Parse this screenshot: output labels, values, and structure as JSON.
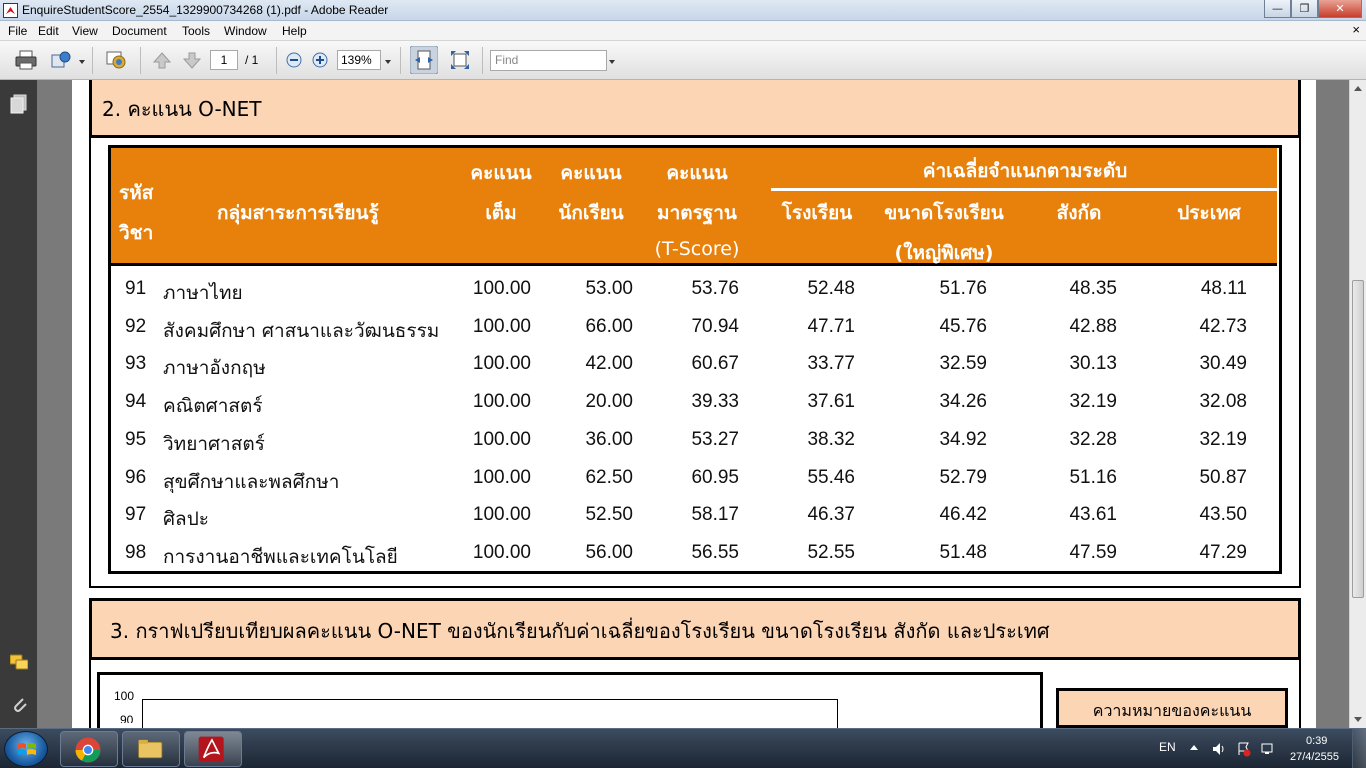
{
  "window": {
    "title": "EnquireStudentScore_2554_1329900734268 (1).pdf - Adobe Reader",
    "minimize_glyph": "—",
    "restore_glyph": "❐",
    "close_glyph": "✕"
  },
  "menu": {
    "items": [
      "File",
      "Edit",
      "View",
      "Document",
      "Tools",
      "Window",
      "Help"
    ],
    "doc_close": "×"
  },
  "toolbar": {
    "page_current": "1",
    "page_total": "/ 1",
    "zoom": "139%",
    "find_placeholder": "Find"
  },
  "section2": {
    "title": "2. คะแนน  O-NET"
  },
  "score_table": {
    "headers": {
      "code_line1": "รหัส",
      "code_line2": "วิชา",
      "subject": "กลุ่มสาระการเรียนรู้",
      "full_line1": "คะแนน",
      "full_line2": "เต็ม",
      "student_line1": "คะแนน",
      "student_line2": "นักเรียน",
      "standard_line1": "คะแนน",
      "standard_line2": "มาตรฐาน",
      "standard_line3": "(T-Score)",
      "avg_group": "ค่าเฉลี่ยจำแนกตามระดับ",
      "school": "โรงเรียน",
      "size_line1": "ขนาดโรงเรียน",
      "size_line2": "(ใหญ่พิเศษ)",
      "affiliation": "สังกัด",
      "country": "ประเทศ"
    },
    "rows": [
      {
        "code": "91",
        "subject": "ภาษาไทย",
        "full": "100.00",
        "student": "53.00",
        "standard": "53.76",
        "school": "52.48",
        "size": "51.76",
        "affiliation": "48.35",
        "country": "48.11"
      },
      {
        "code": "92",
        "subject": "สังคมศึกษา ศาสนาและวัฒนธรรม",
        "full": "100.00",
        "student": "66.00",
        "standard": "70.94",
        "school": "47.71",
        "size": "45.76",
        "affiliation": "42.88",
        "country": "42.73"
      },
      {
        "code": "93",
        "subject": "ภาษาอังกฤษ",
        "full": "100.00",
        "student": "42.00",
        "standard": "60.67",
        "school": "33.77",
        "size": "32.59",
        "affiliation": "30.13",
        "country": "30.49"
      },
      {
        "code": "94",
        "subject": "คณิตศาสตร์",
        "full": "100.00",
        "student": "20.00",
        "standard": "39.33",
        "school": "37.61",
        "size": "34.26",
        "affiliation": "32.19",
        "country": "32.08"
      },
      {
        "code": "95",
        "subject": "วิทยาศาสตร์",
        "full": "100.00",
        "student": "36.00",
        "standard": "53.27",
        "school": "38.32",
        "size": "34.92",
        "affiliation": "32.28",
        "country": "32.19"
      },
      {
        "code": "96",
        "subject": "สุขศึกษาและพลศึกษา",
        "full": "100.00",
        "student": "62.50",
        "standard": "60.95",
        "school": "55.46",
        "size": "52.79",
        "affiliation": "51.16",
        "country": "50.87"
      },
      {
        "code": "97",
        "subject": "ศิลปะ",
        "full": "100.00",
        "student": "52.50",
        "standard": "58.17",
        "school": "46.37",
        "size": "46.42",
        "affiliation": "43.61",
        "country": "43.50"
      },
      {
        "code": "98",
        "subject": "การงานอาชีพและเทคโนโลยี",
        "full": "100.00",
        "student": "56.00",
        "standard": "56.55",
        "school": "52.55",
        "size": "51.48",
        "affiliation": "47.59",
        "country": "47.29"
      }
    ]
  },
  "section3": {
    "title": "3. กราฟเปรียบเทียบผลคะแนน O-NET ของนักเรียนกับค่าเฉลี่ยของโรงเรียน ขนาดโรงเรียน สังกัด และประเทศ",
    "chart_y_top_label": "100",
    "chart_y_next_label": "90",
    "legend_title": "ความหมายของคะแนน"
  },
  "taskbar": {
    "language": "EN",
    "time": "0:39",
    "date": "27/4/2555"
  },
  "colors": {
    "header_orange": "#e8810c",
    "section_peach": "#fcd5b4",
    "reader_red": "#c8161d"
  }
}
